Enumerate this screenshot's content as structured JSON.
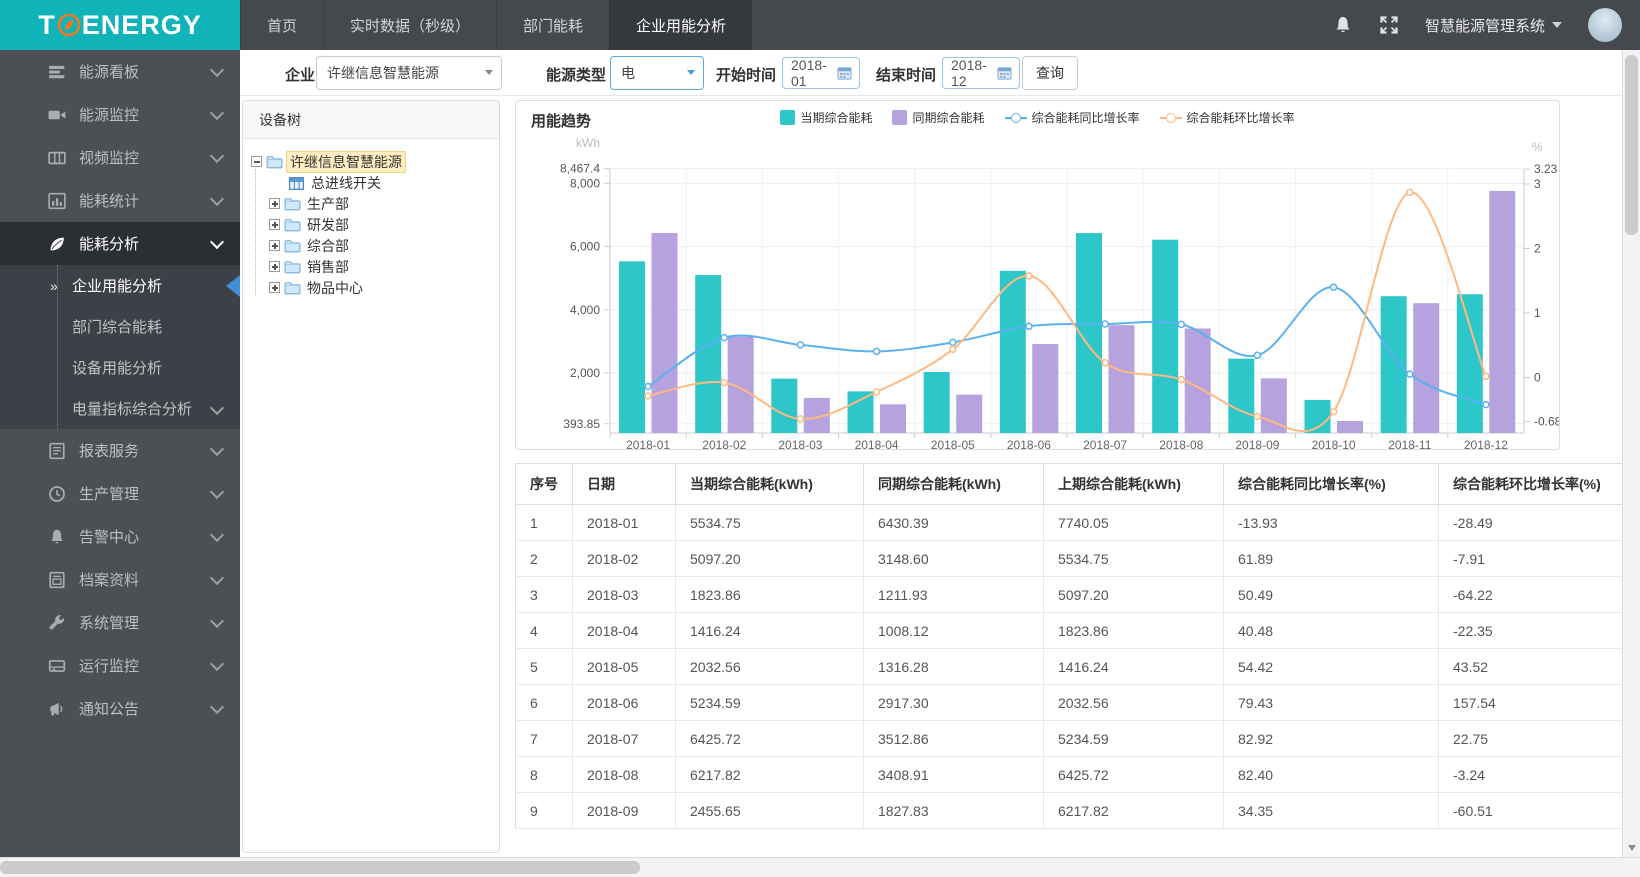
{
  "topbar": {
    "logo_text_left": "T",
    "logo_text_right": "ENERGY",
    "nav": [
      {
        "label": "首页",
        "active": false
      },
      {
        "label": "实时数据（秒级）",
        "active": false
      },
      {
        "label": "部门能耗",
        "active": false
      },
      {
        "label": "企业用能分析",
        "active": true
      }
    ],
    "system_label": "智慧能源管理系统"
  },
  "sidebar": {
    "items": [
      {
        "label": "能源看板",
        "icon": "dashboard"
      },
      {
        "label": "能源监控",
        "icon": "camera"
      },
      {
        "label": "视频监控",
        "icon": "film"
      },
      {
        "label": "能耗统计",
        "icon": "stats"
      },
      {
        "label": "能耗分析",
        "icon": "leaf",
        "expanded": true,
        "children": [
          {
            "label": "企业用能分析",
            "active": true
          },
          {
            "label": "部门综合能耗"
          },
          {
            "label": "设备用能分析"
          },
          {
            "label": "电量指标综合分析",
            "has_children": true
          }
        ]
      },
      {
        "label": "报表服务",
        "icon": "report"
      },
      {
        "label": "生产管理",
        "icon": "clock"
      },
      {
        "label": "告警中心",
        "icon": "bell"
      },
      {
        "label": "档案资料",
        "icon": "archive"
      },
      {
        "label": "系统管理",
        "icon": "wrench"
      },
      {
        "label": "运行监控",
        "icon": "drive"
      },
      {
        "label": "通知公告",
        "icon": "notice"
      }
    ]
  },
  "filters": {
    "company_label": "企业",
    "company_value": "许继信息智慧能源",
    "energy_label": "能源类型",
    "energy_value": "电",
    "start_label": "开始时间",
    "start_value": "2018-01",
    "end_label": "结束时间",
    "end_value": "2018-12",
    "query_label": "查询"
  },
  "tree": {
    "title": "设备树",
    "nodes": [
      {
        "label": "许继信息智慧能源",
        "type": "folder",
        "state": "expanded",
        "selected": true,
        "level": 0
      },
      {
        "label": "总进线开关",
        "type": "meter",
        "level": 1
      },
      {
        "label": "生产部",
        "type": "folder",
        "state": "collapsed",
        "level": 1
      },
      {
        "label": "研发部",
        "type": "folder",
        "state": "collapsed",
        "level": 1
      },
      {
        "label": "综合部",
        "type": "folder",
        "state": "collapsed",
        "level": 1
      },
      {
        "label": "销售部",
        "type": "folder",
        "state": "collapsed",
        "level": 1
      },
      {
        "label": "物品中心",
        "type": "folder",
        "state": "collapsed",
        "level": 1
      }
    ]
  },
  "chart_data": {
    "type": "bar",
    "title": "用能趋势",
    "categories": [
      "2018-01",
      "2018-02",
      "2018-03",
      "2018-04",
      "2018-05",
      "2018-06",
      "2018-07",
      "2018-08",
      "2018-09",
      "2018-10",
      "2018-11",
      "2018-12"
    ],
    "series": [
      {
        "name": "当期综合能耗",
        "type": "bar",
        "axis": "left",
        "color": "#2ec7c9",
        "values": [
          5534.75,
          5097.2,
          1823.86,
          1416.24,
          2032.56,
          5234.59,
          6425.72,
          6217.82,
          2455.65,
          1150,
          4430,
          4495
        ]
      },
      {
        "name": "同期综合能耗",
        "type": "bar",
        "axis": "left",
        "color": "#b6a2de",
        "values": [
          6430.39,
          3148.6,
          1211.93,
          1008.12,
          1316.28,
          2917.3,
          3512.86,
          3408.91,
          1827.83,
          480,
          4210,
          7763
        ]
      },
      {
        "name": "综合能耗同比增长率",
        "type": "line",
        "axis": "right",
        "color": "#5ab1ef",
        "values_pct": [
          -13.93,
          61.89,
          50.49,
          40.48,
          54.42,
          79.43,
          82.92,
          82.4,
          34.35,
          140,
          5.2,
          -42
        ]
      },
      {
        "name": "综合能耗环比增长率",
        "type": "line",
        "axis": "right",
        "color": "#ffb980",
        "values_pct": [
          -28.49,
          -7.91,
          -64.22,
          -22.35,
          43.52,
          157.54,
          22.75,
          -3.24,
          -60.51,
          -53,
          287,
          1.5
        ]
      }
    ],
    "left_axis": {
      "unit": "kWh",
      "tick_labels": [
        "8,467.4",
        "8,000",
        "6,000",
        "4,000",
        "2,000",
        "393.85"
      ],
      "tick_values": [
        8467.4,
        8000,
        6000,
        4000,
        2000,
        393.85
      ]
    },
    "right_axis": {
      "unit": "%",
      "tick_labels": [
        "3.23",
        "3",
        "2",
        "1",
        "0",
        "-0.68"
      ],
      "tick_values": [
        3.23,
        3,
        2,
        1,
        0,
        -0.68
      ]
    },
    "grid": true,
    "legend_position": "top-center"
  },
  "table": {
    "columns": [
      "序号",
      "日期",
      "当期综合能耗(kWh)",
      "同期综合能耗(kWh)",
      "上期综合能耗(kWh)",
      "综合能耗同比增长率(%)",
      "综合能耗环比增长率(%)"
    ],
    "rows": [
      [
        "1",
        "2018-01",
        "5534.75",
        "6430.39",
        "7740.05",
        "-13.93",
        "-28.49"
      ],
      [
        "2",
        "2018-02",
        "5097.20",
        "3148.60",
        "5534.75",
        "61.89",
        "-7.91"
      ],
      [
        "3",
        "2018-03",
        "1823.86",
        "1211.93",
        "5097.20",
        "50.49",
        "-64.22"
      ],
      [
        "4",
        "2018-04",
        "1416.24",
        "1008.12",
        "1823.86",
        "40.48",
        "-22.35"
      ],
      [
        "5",
        "2018-05",
        "2032.56",
        "1316.28",
        "1416.24",
        "54.42",
        "43.52"
      ],
      [
        "6",
        "2018-06",
        "5234.59",
        "2917.30",
        "2032.56",
        "79.43",
        "157.54"
      ],
      [
        "7",
        "2018-07",
        "6425.72",
        "3512.86",
        "5234.59",
        "82.92",
        "22.75"
      ],
      [
        "8",
        "2018-08",
        "6217.82",
        "3408.91",
        "6425.72",
        "82.40",
        "-3.24"
      ],
      [
        "9",
        "2018-09",
        "2455.65",
        "1827.83",
        "6217.82",
        "34.35",
        "-60.51"
      ]
    ]
  }
}
